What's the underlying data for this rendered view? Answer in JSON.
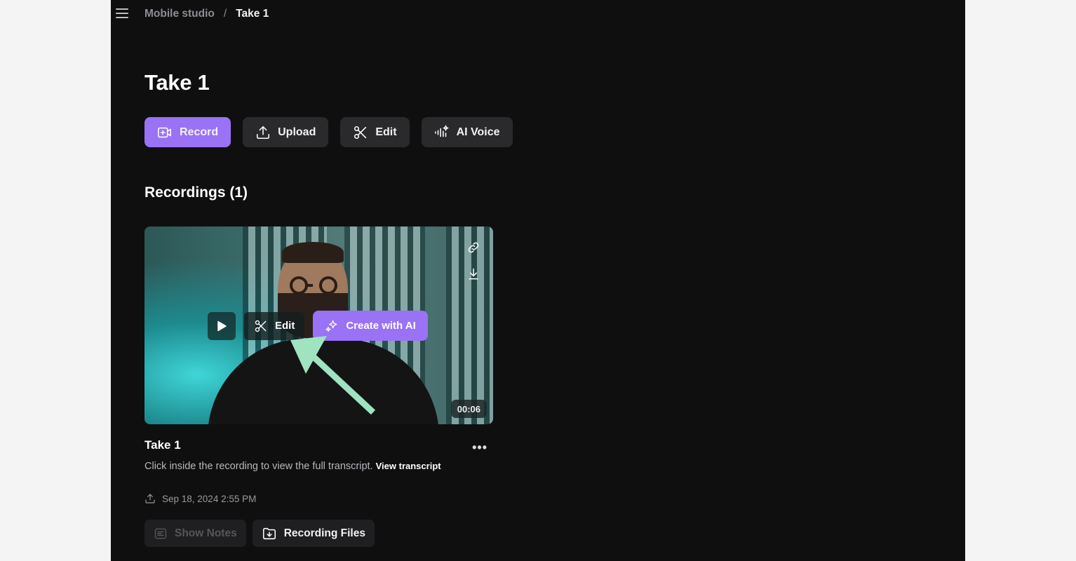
{
  "breadcrumb": {
    "parent": "Mobile studio",
    "separator": "/",
    "current": "Take 1"
  },
  "page": {
    "title": "Take 1"
  },
  "actions": [
    {
      "label": "Record",
      "icon": "video-plus-icon",
      "primary": true
    },
    {
      "label": "Upload",
      "icon": "upload-icon"
    },
    {
      "label": "Edit",
      "icon": "scissors-icon"
    },
    {
      "label": "AI Voice",
      "icon": "ai-voice-icon"
    }
  ],
  "recordings": {
    "title": "Recordings (1)",
    "items": [
      {
        "title": "Take 1",
        "duration": "00:06",
        "overlay": {
          "edit_label": "Edit",
          "ai_label": "Create with AI"
        },
        "description": "Click inside the recording to view the full transcript.",
        "transcript_link": "View transcript",
        "date": "Sep 18, 2024 2:55 PM",
        "buttons": {
          "notes": "Show Notes",
          "files": "Recording Files"
        }
      }
    ]
  },
  "colors": {
    "accent": "#9a72f5",
    "background": "#0f0f10",
    "annotation_arrow": "#9fe3c0"
  }
}
